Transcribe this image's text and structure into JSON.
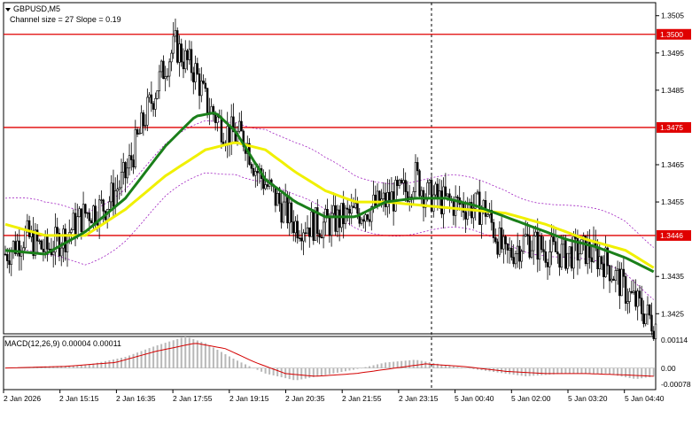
{
  "window": {
    "symbol_title": "GBPUSD,M5",
    "channel_info": "Channel size = 27 Slope = 0.19"
  },
  "colors": {
    "background": "#ffffff",
    "candle": "#000000",
    "level_line": "#e00000",
    "ma_fast": "#1a7f1a",
    "ma_slow": "#f0f000",
    "envelope": "#a020c0",
    "macd_hist": "#b8b8b8",
    "macd_signal": "#d40000"
  },
  "price_axis": {
    "ticks": [
      "1.3505",
      "1.3495",
      "1.3485",
      "1.3465",
      "1.3455",
      "1.3435",
      "1.3425"
    ],
    "ylim": [
      1.34196,
      1.35085
    ]
  },
  "levels": [
    {
      "label": "1.3500",
      "value": 1.35
    },
    {
      "label": "1.3475",
      "value": 1.3475
    },
    {
      "label": "1.3446",
      "value": 1.3446
    }
  ],
  "time_axis": {
    "labels": [
      "2 Jan 2026",
      "2 Jan 15:15",
      "2 Jan 16:35",
      "2 Jan 17:55",
      "2 Jan 19:15",
      "2 Jan 20:35",
      "2 Jan 21:55",
      "2 Jan 23:15",
      "5 Jan 00:40",
      "5 Jan 02:00",
      "5 Jan 03:20",
      "5 Jan 04:40"
    ]
  },
  "macd": {
    "label": "MACD(12,26,9) 0.00004 0.00011",
    "ticks": [
      "0.00114",
      "0.00",
      "-0.00078"
    ],
    "ylim": [
      -0.00078,
      0.00114
    ]
  },
  "chart_data": {
    "type": "candlestick",
    "price_anchors": [
      [
        0,
        1.3441
      ],
      [
        10,
        1.3446
      ],
      [
        20,
        1.3442
      ],
      [
        30,
        1.3446
      ],
      [
        40,
        1.3452
      ],
      [
        50,
        1.3454
      ],
      [
        60,
        1.3462
      ],
      [
        70,
        1.3478
      ],
      [
        80,
        1.3492
      ],
      [
        85,
        1.3497
      ],
      [
        90,
        1.3493
      ],
      [
        95,
        1.349
      ],
      [
        100,
        1.3482
      ],
      [
        110,
        1.3474
      ],
      [
        120,
        1.3472
      ],
      [
        125,
        1.3464
      ],
      [
        135,
        1.3456
      ],
      [
        145,
        1.3449
      ],
      [
        160,
        1.3449
      ],
      [
        175,
        1.3452
      ],
      [
        190,
        1.3455
      ],
      [
        200,
        1.3458
      ],
      [
        205,
        1.3462
      ],
      [
        210,
        1.3457
      ],
      [
        220,
        1.3455
      ],
      [
        240,
        1.3453
      ],
      [
        250,
        1.344
      ],
      [
        260,
        1.3445
      ],
      [
        270,
        1.3442
      ],
      [
        280,
        1.3441
      ],
      [
        290,
        1.3442
      ],
      [
        300,
        1.3439
      ],
      [
        310,
        1.3431
      ],
      [
        320,
        1.3425
      ],
      [
        325,
        1.3422
      ]
    ],
    "ma_fast": [
      [
        0,
        1.3442
      ],
      [
        20,
        1.3441
      ],
      [
        40,
        1.3447
      ],
      [
        60,
        1.3456
      ],
      [
        80,
        1.347
      ],
      [
        95,
        1.3478
      ],
      [
        105,
        1.3479
      ],
      [
        115,
        1.3474
      ],
      [
        130,
        1.3461
      ],
      [
        145,
        1.3455
      ],
      [
        160,
        1.3451
      ],
      [
        175,
        1.3451
      ],
      [
        190,
        1.3455
      ],
      [
        205,
        1.3456
      ],
      [
        220,
        1.3456
      ],
      [
        235,
        1.3454
      ],
      [
        250,
        1.3451
      ],
      [
        265,
        1.3448
      ],
      [
        280,
        1.3445
      ],
      [
        295,
        1.3443
      ],
      [
        310,
        1.344
      ],
      [
        325,
        1.3436
      ]
    ],
    "ma_slow": [
      [
        0,
        1.3449
      ],
      [
        20,
        1.3446
      ],
      [
        40,
        1.3446
      ],
      [
        60,
        1.3453
      ],
      [
        80,
        1.3462
      ],
      [
        100,
        1.3469
      ],
      [
        115,
        1.3471
      ],
      [
        130,
        1.3469
      ],
      [
        145,
        1.3463
      ],
      [
        160,
        1.3458
      ],
      [
        175,
        1.3455
      ],
      [
        190,
        1.3455
      ],
      [
        210,
        1.3454
      ],
      [
        230,
        1.3453
      ],
      [
        250,
        1.3452
      ],
      [
        270,
        1.3449
      ],
      [
        290,
        1.3445
      ],
      [
        310,
        1.3442
      ],
      [
        325,
        1.3437
      ]
    ],
    "envelope_offset": 0.0007,
    "macd_hist": [
      [
        0,
        0.0
      ],
      [
        20,
        6e-05
      ],
      [
        40,
        0.0001
      ],
      [
        60,
        0.0004
      ],
      [
        75,
        0.0008
      ],
      [
        90,
        0.00114
      ],
      [
        100,
        0.0009
      ],
      [
        115,
        0.0003
      ],
      [
        130,
        -0.0002
      ],
      [
        145,
        -0.00045
      ],
      [
        160,
        -0.00025
      ],
      [
        175,
        -5e-05
      ],
      [
        190,
        0.0002
      ],
      [
        205,
        0.0003
      ],
      [
        220,
        0.0001
      ],
      [
        240,
        -0.0001
      ],
      [
        260,
        -0.0003
      ],
      [
        280,
        -0.0002
      ],
      [
        300,
        -0.0002
      ],
      [
        315,
        -0.0004
      ],
      [
        325,
        -0.0003
      ]
    ],
    "macd_signal": [
      [
        0,
        0.0
      ],
      [
        30,
        6e-05
      ],
      [
        55,
        0.0002
      ],
      [
        75,
        0.0006
      ],
      [
        95,
        0.0009
      ],
      [
        110,
        0.0007
      ],
      [
        125,
        0.0002
      ],
      [
        140,
        -0.0002
      ],
      [
        155,
        -0.0003
      ],
      [
        175,
        -0.0002
      ],
      [
        195,
        0.0
      ],
      [
        210,
        0.00015
      ],
      [
        230,
        5e-05
      ],
      [
        250,
        -0.00012
      ],
      [
        270,
        -0.0002
      ],
      [
        290,
        -0.0002
      ],
      [
        310,
        -0.00025
      ],
      [
        325,
        -0.0003
      ]
    ]
  }
}
